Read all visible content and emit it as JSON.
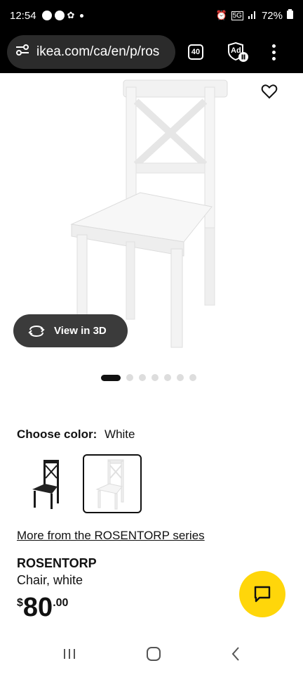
{
  "status_bar": {
    "time": "12:54",
    "battery": "72%"
  },
  "browser": {
    "url": "ikea.com/ca/en/p/ros",
    "tab_count": "40",
    "adblock_label": "Ad"
  },
  "product": {
    "view_3d_label": "View in 3D",
    "carousel_total": 7,
    "carousel_active": 1,
    "color_label": "Choose color:",
    "color_value": "White",
    "series_link": "More from the ROSENTORP series",
    "name": "ROSENTORP",
    "description": "Chair, white",
    "price_currency": "$",
    "price_int": "80",
    "price_dec": ".00"
  },
  "colors": {
    "accent_yellow": "#ffd60a",
    "dark": "#111111"
  }
}
